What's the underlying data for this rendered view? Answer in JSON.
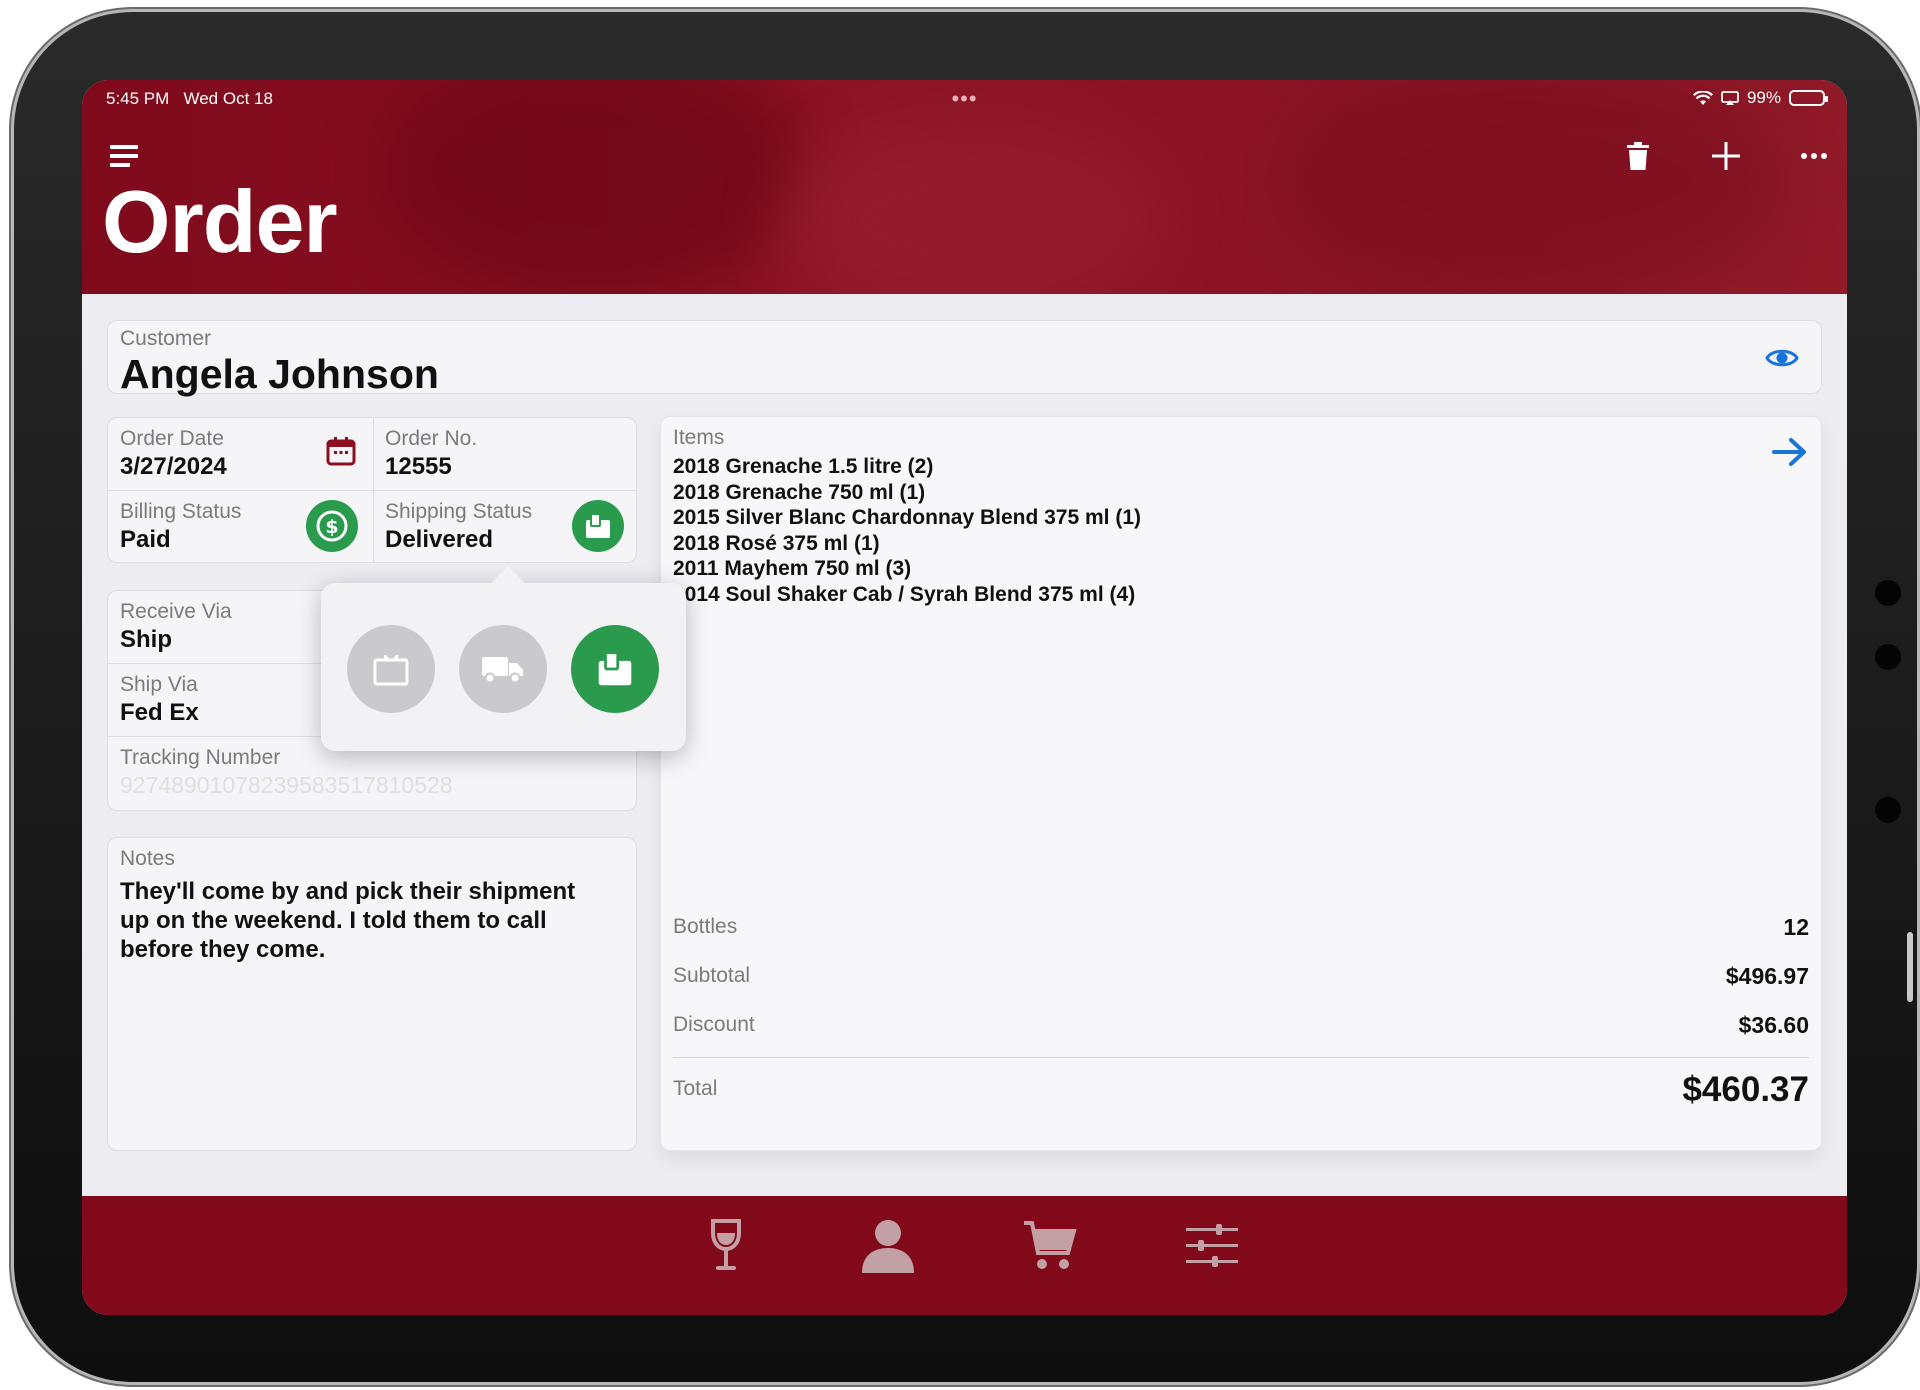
{
  "status_bar": {
    "time": "5:45 PM",
    "date": "Wed Oct 18",
    "battery": "99%"
  },
  "header": {
    "title": "Order"
  },
  "customer": {
    "label": "Customer",
    "name": "Angela Johnson"
  },
  "order": {
    "date_label": "Order Date",
    "date": "3/27/2024",
    "number_label": "Order No.",
    "number": "12555",
    "billing_label": "Billing Status",
    "billing": "Paid",
    "shipping_label": "Shipping Status",
    "shipping": "Delivered"
  },
  "shipping": {
    "receive_label": "Receive Via",
    "receive": "Ship",
    "ship_via_label": "Ship Via",
    "ship_via": "Fed Ex",
    "tracking_label": "Tracking Number",
    "tracking": "9274890107823958351781052​8"
  },
  "notes": {
    "label": "Notes",
    "text": "They'll come by and pick their shipment up on the weekend. I told them to call before they come."
  },
  "items": {
    "label": "Items",
    "list": [
      "2018 Grenache 1.5 litre (2)",
      "2018 Grenache 750 ml (1)",
      "2015 Silver Blanc Chardonnay Blend 375 ml (1)",
      "2018 Rosé 375 ml (1)",
      "2011 Mayhem 750 ml (3)",
      "2014 Soul Shaker Cab / Syrah Blend 375 ml (4)"
    ]
  },
  "totals": {
    "bottles_label": "Bottles",
    "bottles": "12",
    "subtotal_label": "Subtotal",
    "subtotal": "$496.97",
    "discount_label": "Discount",
    "discount": "$36.60",
    "total_label": "Total",
    "total": "$460.37"
  },
  "shipping_status_options": [
    "pending-package-icon",
    "in-transit-truck-icon",
    "delivered-package-icon"
  ],
  "shipping_status_selected": 2,
  "colors": {
    "brand": "#82091a",
    "accent_green": "#2a9b4d",
    "link_blue": "#1a73d9",
    "muted_gray": "#c9c9ce"
  }
}
